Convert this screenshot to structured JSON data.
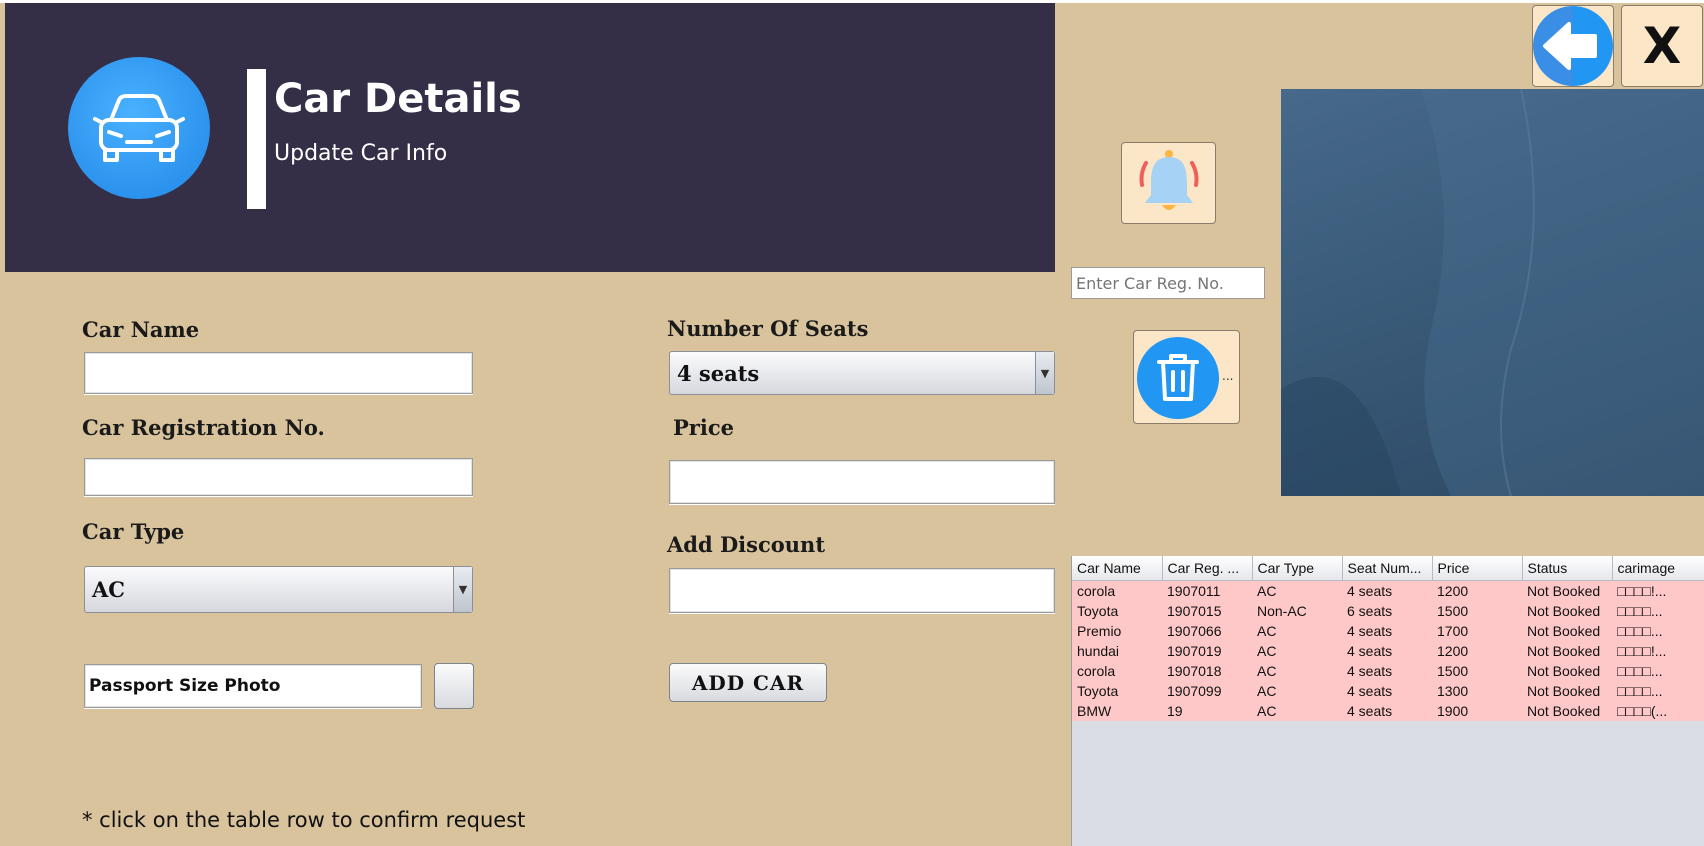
{
  "header": {
    "title": "Car Details",
    "subtitle": "Update Car Info",
    "logo_icon": "car-icon",
    "bg_color": "#342f47"
  },
  "form": {
    "car_name": {
      "label": "Car Name",
      "value": ""
    },
    "car_reg": {
      "label": "Car Registration  No.",
      "value": ""
    },
    "car_type": {
      "label": "Car Type",
      "selected": "AC"
    },
    "photo": {
      "field_text": "Passport Size Photo"
    },
    "seats": {
      "label": "Number Of Seats",
      "selected": "4 seats"
    },
    "price": {
      "label": "Price",
      "value": ""
    },
    "discount": {
      "label": "Add Discount",
      "value": ""
    },
    "add_button": "ADD CAR",
    "hint": "* click  on the table row to confirm request"
  },
  "side": {
    "search_placeholder": "Enter Car Reg. No.",
    "notify_icon": "bell-icon",
    "delete_icon": "trash-icon",
    "delete_ellipsis": "...",
    "back_icon": "arrow-left-icon",
    "close_label": "X"
  },
  "table": {
    "columns": [
      "Car Name",
      "Car Reg. ...",
      "Car Type",
      "Seat Num...",
      "Price",
      "Status",
      "carimage"
    ],
    "rows": [
      [
        "corola",
        "1907011",
        "AC",
        "4 seats",
        "1200",
        "Not Booked",
        "□□□□!..."
      ],
      [
        "Toyota",
        "1907015",
        "Non-AC",
        "6 seats",
        "1500",
        "Not Booked",
        "□□□□..."
      ],
      [
        "Premio",
        "1907066",
        "AC",
        "4 seats",
        "1700",
        "Not Booked",
        "□□□□..."
      ],
      [
        "hundai",
        "1907019",
        "AC",
        "4 seats",
        "1200",
        "Not Booked",
        "□□□□!..."
      ],
      [
        "corola",
        "1907018",
        "AC",
        "4 seats",
        "1500",
        "Not Booked",
        "□□□□..."
      ],
      [
        "Toyota",
        "1907099",
        "AC",
        "4 seats",
        "1300",
        "Not Booked",
        "□□□□..."
      ],
      [
        "BMW",
        "19",
        "AC",
        "4 seats",
        "1900",
        "Not Booked",
        "□□□□(..."
      ]
    ],
    "row_color": "#ffc8c8"
  },
  "colors": {
    "background": "#d8c39c",
    "accent_blue": "#2196f3"
  }
}
